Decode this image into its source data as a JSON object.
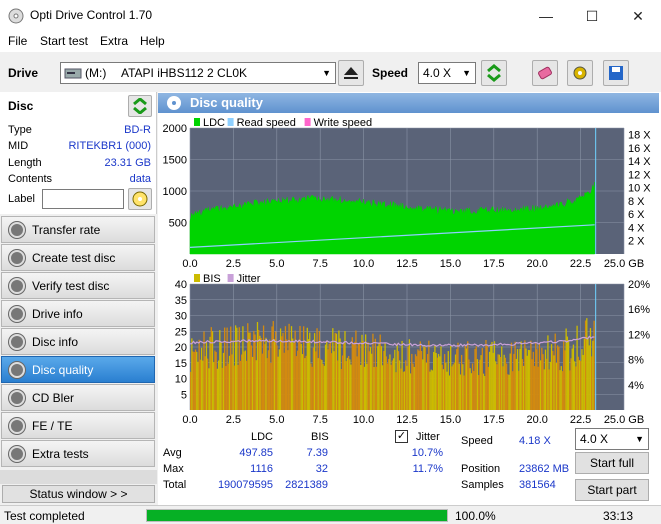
{
  "window": {
    "title": "Opti Drive Control 1.70",
    "min": "—",
    "max": "☐",
    "close": "✕"
  },
  "menu": [
    "File",
    "Start test",
    "Extra",
    "Help"
  ],
  "toolbar": {
    "drive_label": "Drive",
    "drive_letter": "(M:)",
    "drive_name": "ATAPI iHBS112  2 CL0K",
    "speed_label": "Speed",
    "speed_value": "4.0 X"
  },
  "disc": {
    "heading": "Disc",
    "rows": [
      {
        "key": "Type",
        "value": "BD-R"
      },
      {
        "key": "MID",
        "value": "RITEKBR1 (000)"
      },
      {
        "key": "Length",
        "value": "23.31 GB"
      },
      {
        "key": "Contents",
        "value": "data"
      }
    ],
    "label_key": "Label",
    "label_value": ""
  },
  "nav": [
    {
      "label": "Transfer rate",
      "active": false
    },
    {
      "label": "Create test disc",
      "active": false
    },
    {
      "label": "Verify test disc",
      "active": false
    },
    {
      "label": "Drive info",
      "active": false
    },
    {
      "label": "Disc info",
      "active": false
    },
    {
      "label": "Disc quality",
      "active": true
    },
    {
      "label": "CD Bler",
      "active": false
    },
    {
      "label": "FE / TE",
      "active": false
    },
    {
      "label": "Extra tests",
      "active": false
    }
  ],
  "status_window_btn": "Status window > >",
  "panel_title": "Disc quality",
  "chart_data": [
    {
      "type": "area",
      "legend": [
        "LDC",
        "Read speed",
        "Write speed"
      ],
      "x_ticks": [
        "0.0",
        "2.5",
        "5.0",
        "7.5",
        "10.0",
        "12.5",
        "15.0",
        "17.5",
        "20.0",
        "22.5",
        "25.0 GB"
      ],
      "y_ticks_left": [
        "2000",
        "1500",
        "1000",
        "500"
      ],
      "y_ticks_right": [
        "18 X",
        "16 X",
        "14 X",
        "12 X",
        "10 X",
        "8 X",
        "6 X",
        "4 X",
        "2 X"
      ],
      "xlim": [
        0,
        25
      ],
      "ylim": [
        0,
        2000
      ],
      "y2lim": [
        0,
        19
      ],
      "colors": {
        "ldc": "#00d400",
        "read": "#8fd0ff",
        "write": "#ff66cc",
        "bg": "#5a6378"
      },
      "series": [
        {
          "name": "LDC",
          "x": [
            0,
            0.5,
            1,
            2,
            3,
            4,
            5,
            6,
            7,
            8,
            9,
            10,
            11,
            12,
            13,
            14,
            15,
            16,
            17,
            18,
            19,
            20,
            21,
            22,
            22.5,
            23,
            23.31
          ],
          "values": [
            580,
            650,
            700,
            720,
            760,
            820,
            830,
            860,
            880,
            870,
            850,
            820,
            790,
            760,
            730,
            700,
            690,
            680,
            690,
            700,
            710,
            720,
            760,
            840,
            900,
            960,
            1100
          ]
        },
        {
          "name": "Read speed",
          "x": [
            0,
            23.31
          ],
          "values": [
            1.0,
            4.4
          ]
        }
      ]
    },
    {
      "type": "bar",
      "legend": [
        "BIS",
        "Jitter"
      ],
      "x_ticks": [
        "0.0",
        "2.5",
        "5.0",
        "7.5",
        "10.0",
        "12.5",
        "15.0",
        "17.5",
        "20.0",
        "22.5",
        "25.0 GB"
      ],
      "y_ticks_left": [
        "40",
        "35",
        "30",
        "25",
        "20",
        "15",
        "10",
        "5"
      ],
      "y_ticks_right": [
        "20%",
        "16%",
        "12%",
        "8%",
        "4%"
      ],
      "xlim": [
        0,
        25
      ],
      "ylim": [
        0,
        40
      ],
      "y2lim": [
        0,
        20
      ],
      "colors": {
        "bis": "#ccbb00",
        "jitter": "#c8a0d8",
        "bg": "#5a6378"
      },
      "series": [
        {
          "name": "BIS",
          "x": [
            0,
            2,
            4,
            6,
            8,
            10,
            12,
            14,
            16,
            18,
            20,
            22,
            23.31
          ],
          "values": [
            22,
            24,
            25,
            24,
            23,
            22,
            20,
            19,
            19,
            20,
            21,
            23,
            30
          ]
        },
        {
          "name": "Jitter",
          "x": [
            0,
            2,
            4,
            6,
            8,
            10,
            12,
            14,
            16,
            18,
            20,
            22,
            23.31
          ],
          "values": [
            10.7,
            10.9,
            11.0,
            10.9,
            10.8,
            10.6,
            10.4,
            10.3,
            10.3,
            10.4,
            10.6,
            11.0,
            11.7
          ]
        }
      ]
    }
  ],
  "stats": {
    "col_ldc": "LDC",
    "col_bis": "BIS",
    "jitter_label": "Jitter",
    "jitter_checked": "✓",
    "rows": [
      {
        "label": "Avg",
        "ldc": "497.85",
        "bis": "7.39",
        "jitter": "10.7%"
      },
      {
        "label": "Max",
        "ldc": "1116",
        "bis": "32",
        "jitter": "11.7%"
      },
      {
        "label": "Total",
        "ldc": "190079595",
        "bis": "2821389",
        "jitter": ""
      }
    ],
    "speed_label": "Speed",
    "speed_value": "4.18 X",
    "position_label": "Position",
    "position_value": "23862 MB",
    "samples_label": "Samples",
    "samples_value": "381564",
    "speed_select": "4.0 X",
    "start_full": "Start full",
    "start_part": "Start part"
  },
  "status": {
    "text": "Test completed",
    "progress": 100.0,
    "progress_label": "100.0%",
    "time": "33:13"
  }
}
